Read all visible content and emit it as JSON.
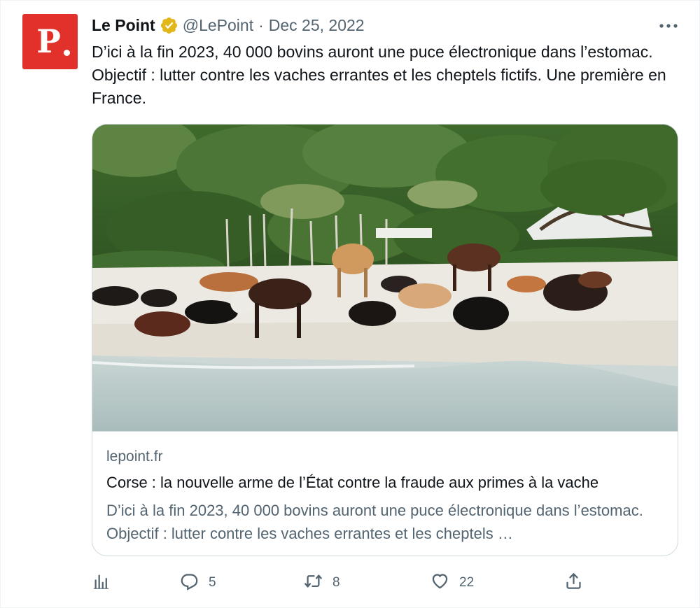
{
  "author": {
    "name": "Le Point",
    "handle": "@LePoint",
    "separator": "·",
    "date": "Dec 25, 2022",
    "avatar_letter": "P",
    "avatar_color": "#e2312b",
    "verified_icon": "verified-gold-badge-icon"
  },
  "tweet": {
    "text": "D’ici à la fin 2023, 40 000 bovins auront une puce électronique dans l’estomac. Objectif : lutter contre les vaches errantes et les cheptels fictifs. Une première en France."
  },
  "card": {
    "image_icon": "cows-on-beach-photo",
    "domain": "lepoint.fr",
    "title": "Corse : la nouvelle arme de l’État contre la fraude aux primes à la vache",
    "description": "D’ici à la fin 2023, 40 000 bovins auront une puce électronique dans l’estomac. Objectif : lutter contre les vaches errantes et les cheptels …"
  },
  "actions": {
    "analytics": {
      "icon": "analytics-icon",
      "count": ""
    },
    "reply": {
      "icon": "reply-icon",
      "count": "5"
    },
    "retweet": {
      "icon": "retweet-icon",
      "count": "8"
    },
    "like": {
      "icon": "heart-icon",
      "count": "22"
    },
    "share": {
      "icon": "share-icon",
      "count": ""
    }
  },
  "more_icon": "more-options-icon",
  "colors": {
    "text_primary": "#0f1419",
    "text_secondary": "#536471",
    "border": "#cfd9de",
    "verified_gold": "#e2b719"
  }
}
